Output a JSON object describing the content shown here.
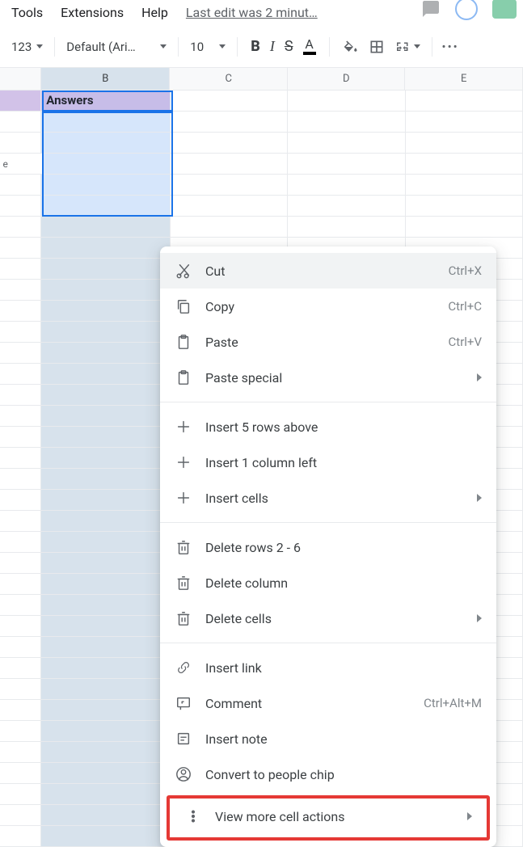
{
  "menubar": {
    "items": [
      "Tools",
      "Extensions",
      "Help"
    ],
    "last_edit": "Last edit was 2 minut…"
  },
  "toolbar": {
    "num_format": "123",
    "font_name": "Default (Ari…",
    "font_size": "10"
  },
  "columns": [
    "",
    "B",
    "C",
    "D",
    "E"
  ],
  "header_row": {
    "b": "Answers"
  },
  "row4_marker": "e",
  "context_menu": {
    "groups": [
      [
        {
          "icon": "cut",
          "label": "Cut",
          "shortcut": "Ctrl+X",
          "hover": true
        },
        {
          "icon": "copy",
          "label": "Copy",
          "shortcut": "Ctrl+C"
        },
        {
          "icon": "paste",
          "label": "Paste",
          "shortcut": "Ctrl+V"
        },
        {
          "icon": "paste",
          "label": "Paste special",
          "submenu": true
        }
      ],
      [
        {
          "icon": "plus",
          "label": "Insert 5 rows above"
        },
        {
          "icon": "plus",
          "label": "Insert 1 column left"
        },
        {
          "icon": "plus",
          "label": "Insert cells",
          "submenu": true
        }
      ],
      [
        {
          "icon": "trash",
          "label": "Delete rows 2 - 6"
        },
        {
          "icon": "trash",
          "label": "Delete column"
        },
        {
          "icon": "trash",
          "label": "Delete cells",
          "submenu": true
        }
      ],
      [
        {
          "icon": "link",
          "label": "Insert link"
        },
        {
          "icon": "comment",
          "label": "Comment",
          "shortcut": "Ctrl+Alt+M"
        },
        {
          "icon": "note",
          "label": "Insert note"
        },
        {
          "icon": "person",
          "label": "Convert to people chip"
        }
      ]
    ],
    "highlighted": {
      "icon": "more",
      "label": "View more cell actions",
      "submenu": true
    }
  }
}
